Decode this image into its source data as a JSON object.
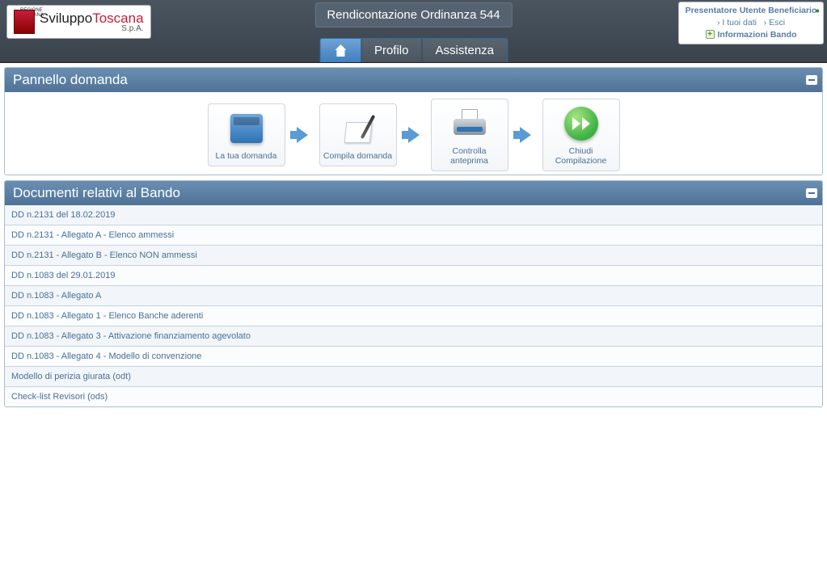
{
  "logo": {
    "regione": "REGIONE TOSCANA",
    "sviluppo": "Sviluppo",
    "toscana": "Toscana",
    "spa": "S.p.A."
  },
  "title_badge": "Rendicontazione Ordinanza 544",
  "user_panel": {
    "role_label": "Presentatore",
    "user_name": "Utente Beneficiario",
    "link_dati": "I tuoi dati",
    "link_esci": "Esci",
    "info_bando": "Informazioni Bando"
  },
  "nav": {
    "home": "",
    "profilo": "Profilo",
    "assistenza": "Assistenza"
  },
  "panel_domanda": {
    "title": "Pannello domanda",
    "workflow": [
      {
        "icon": "drawer",
        "label": "La tua domanda"
      },
      {
        "icon": "pen",
        "label": "Compila domanda"
      },
      {
        "icon": "printer",
        "label": "Controlla anteprima"
      },
      {
        "icon": "go",
        "label": "Chiudi Compilazione"
      }
    ]
  },
  "panel_documenti": {
    "title": "Documenti relativi al Bando",
    "items": [
      "DD n.2131 del 18.02.2019",
      "DD n.2131 - Allegato A - Elenco ammessi",
      "DD n.2131 - Allegato B - Elenco NON ammessi",
      "DD n.1083 del 29.01.2019",
      "DD n.1083 - Allegato A",
      "DD n.1083 - Allegato 1 - Elenco Banche aderenti",
      "DD n.1083 - Allegato 3 - Attivazione finanziamento agevolato",
      "DD n.1083 - Allegato 4 - Modello di convenzione",
      "Modello di perizia giurata (odt)",
      "Check-list Revisori (ods)"
    ]
  }
}
